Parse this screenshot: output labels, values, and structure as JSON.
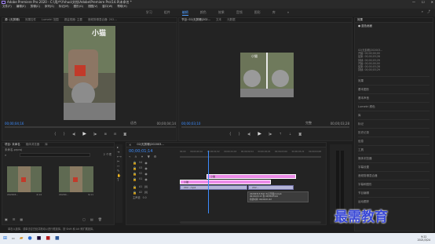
{
  "window": {
    "title": "Adobe Premiere Pro 2020 - C:\\用户\\Yshuo\\文档\\Adobe\\Premiere Pro\\14.0\\未命名 *"
  },
  "menu": [
    "文件(F)",
    "编辑(E)",
    "剪辑(C)",
    "序列(S)",
    "标记(M)",
    "图形(G)",
    "视图(V)",
    "窗口(W)",
    "帮助(H)"
  ],
  "workspaces": {
    "items": [
      "学习",
      "组件",
      "编辑",
      "颜色",
      "效果",
      "音频",
      "图形",
      "库"
    ],
    "active_index": 2
  },
  "source_monitor": {
    "tabs": [
      "源: (无剪辑)",
      "效果控件",
      "Lumetri 范围",
      "源监视器: 主要",
      "音频剪辑混合器: 202..."
    ],
    "overlay_text": "小猫",
    "timecode": "00;00;04;16",
    "fit": "适合",
    "duration": "00;00;04;14"
  },
  "program_monitor": {
    "tabs": [
      "节目: 02(无剪辑)202...",
      "文本",
      "元数据"
    ],
    "timecode": "00;00;03;10",
    "fit": "完整",
    "duration": "00;00;03;28",
    "overlay_text": "小猫"
  },
  "effects_panel": {
    "title": "效果",
    "preset": "● 蓝色画面",
    "info_lines": [
      "02(无剪辑)202003...",
      "开始: 00;00;00;00",
      "结束: 00;00;03;28",
      "持续: 00;00;03;29",
      "开始: 00;00;00;00",
      "结束: 00;00;03;28",
      "持续: 00;00;03;29"
    ],
    "list": [
      "效果",
      "基本图形",
      "基本声音",
      "Lumetri 颜色",
      "库",
      "标记",
      "历史记录",
      "信息",
      "工具",
      "媒体浏览器",
      "字幕设置",
      "音频剪辑混合器",
      "字幕和图形",
      "节目编辑",
      "运动跟踪"
    ]
  },
  "project_panel": {
    "tabs": [
      "项目: 未命名",
      "媒体浏览器",
      "库"
    ],
    "file": "未命名.prproj",
    "search_placeholder": "",
    "count": "2 个项",
    "items": [
      {
        "name": "202003...",
        "duration": "4;14"
      },
      {
        "name": "20200...",
        "duration": "9;11"
      }
    ]
  },
  "timeline": {
    "tab": "02(无剪辑)202003...",
    "timecode": "00;00;01;14",
    "ruler": [
      "00;00",
      "00;00;00;16",
      "00;00;01;02",
      "00;00;01;18",
      "00;00;02;04",
      "00;00;02;20",
      "00;00;03;06",
      "00;00;03;22",
      "00;00;04;08"
    ],
    "tracks": [
      {
        "name": "V4",
        "clips": []
      },
      {
        "name": "V3",
        "clips": [
          {
            "label": "小猫",
            "kind": "title"
          }
        ]
      },
      {
        "name": "V2",
        "clips": [
          {
            "label": "小猫",
            "kind": "title"
          }
        ]
      },
      {
        "name": "V1",
        "clips": [
          {
            "label": "202...mp4",
            "kind": "video"
          },
          {
            "label": "202...",
            "kind": "video"
          }
        ]
      },
      {
        "name": "A1",
        "clips": []
      },
      {
        "name": "A2",
        "clips": []
      },
      {
        "name": "主声道",
        "clips": []
      }
    ],
    "tooltip": [
      "202003131527-3(无剪辑)4.mp4",
      "00;00;03;13 到 00;00;05;04",
      "持续时间: 00;00;01;22"
    ],
    "mix_value": "0.0"
  },
  "status_bar": {
    "text": "单击以选择，或单击空白处并拖动以进行框选择。按 Shift 和 Alt 来扩展选择。"
  },
  "watermark": "最需教育",
  "taskbar": {
    "time": "9:22",
    "date": "2021/3/24"
  },
  "colors": {
    "accent": "#3c8cff",
    "title_clip": "#ec8be8",
    "video_clip": "#b4b4d7",
    "background": "#1d1d1d"
  }
}
